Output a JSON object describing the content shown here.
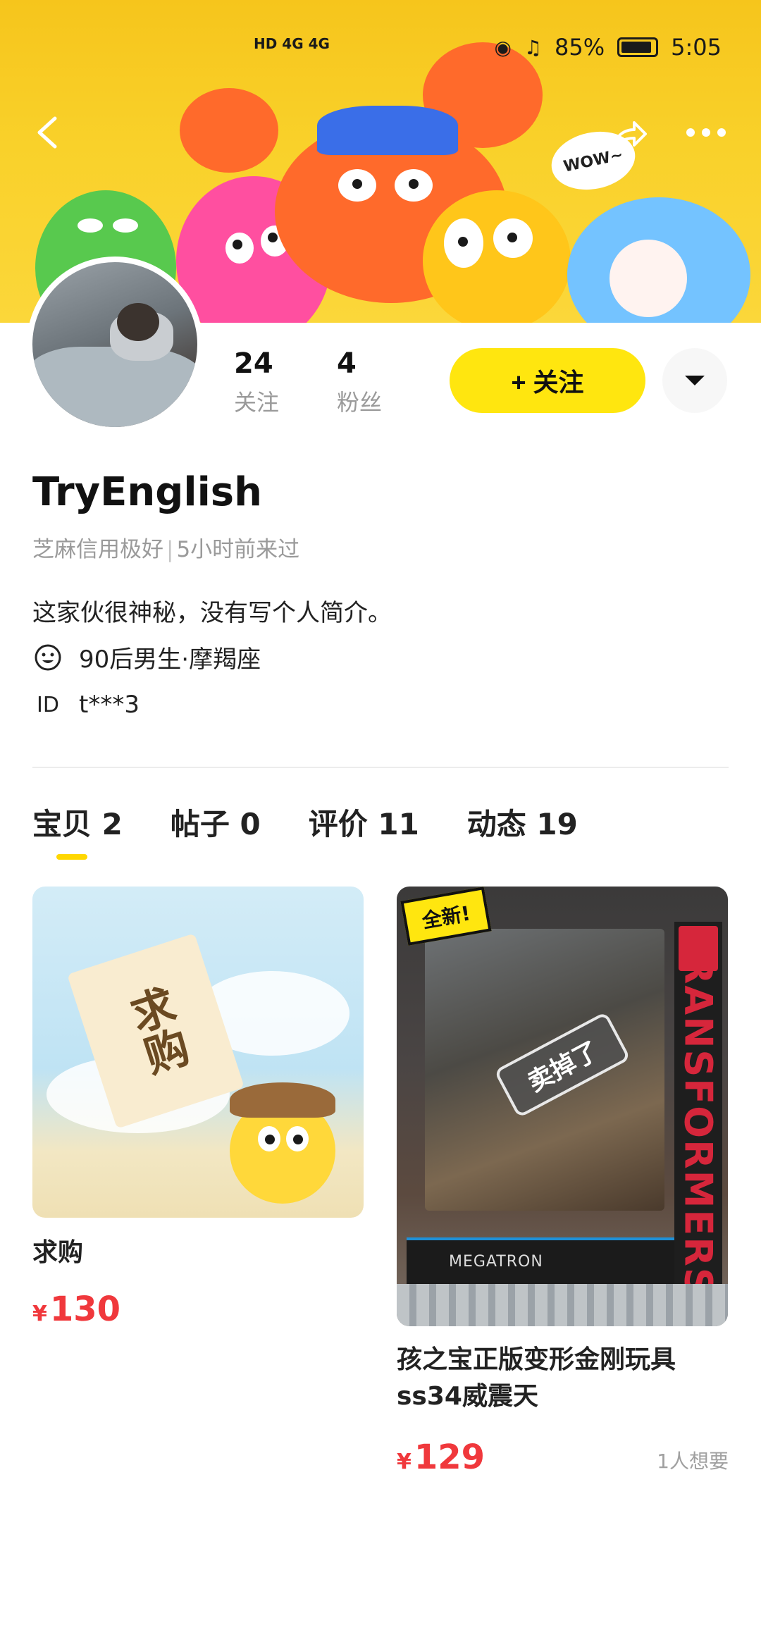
{
  "status_bar": {
    "network_label": "HD 4G 4G",
    "battery": "85%",
    "time": "5:05"
  },
  "banner": {
    "bubble_text": "WOW~"
  },
  "profile": {
    "username": "TryEnglish",
    "credit": "芝麻信用极好",
    "meta_separator": "|",
    "last_seen": "5小时前来过",
    "bio": "这家伙很神秘，没有写个人简介。",
    "demographic": "90后男生·摩羯座",
    "id_label": "ID",
    "id_value": "t***3"
  },
  "stats": {
    "following_count": "24",
    "following_label": "关注",
    "followers_count": "4",
    "followers_label": "粉丝"
  },
  "actions": {
    "follow_label": "+ 关注"
  },
  "tabs": [
    {
      "label": "宝贝 2",
      "active": true
    },
    {
      "label": "帖子 0",
      "active": false
    },
    {
      "label": "评价 11",
      "active": false
    },
    {
      "label": "动态 19",
      "active": false
    }
  ],
  "items": [
    {
      "image_text": "求购",
      "title": "求购",
      "currency": "¥",
      "price": "130"
    },
    {
      "badge": "全新!",
      "brand_vertical": "TRANSFORMERS",
      "box_label": "MEGATRON",
      "sold_stamp": "卖掉了",
      "title_line1": "孩之宝正版变形金刚玩具",
      "title_line2": "ss34威震天",
      "currency": "¥",
      "price": "129",
      "wants": "1人想要"
    }
  ],
  "colors": {
    "accent_yellow": "#ffe60f",
    "price_red": "#f0383c",
    "banner_yellow": "#f9d12a"
  }
}
